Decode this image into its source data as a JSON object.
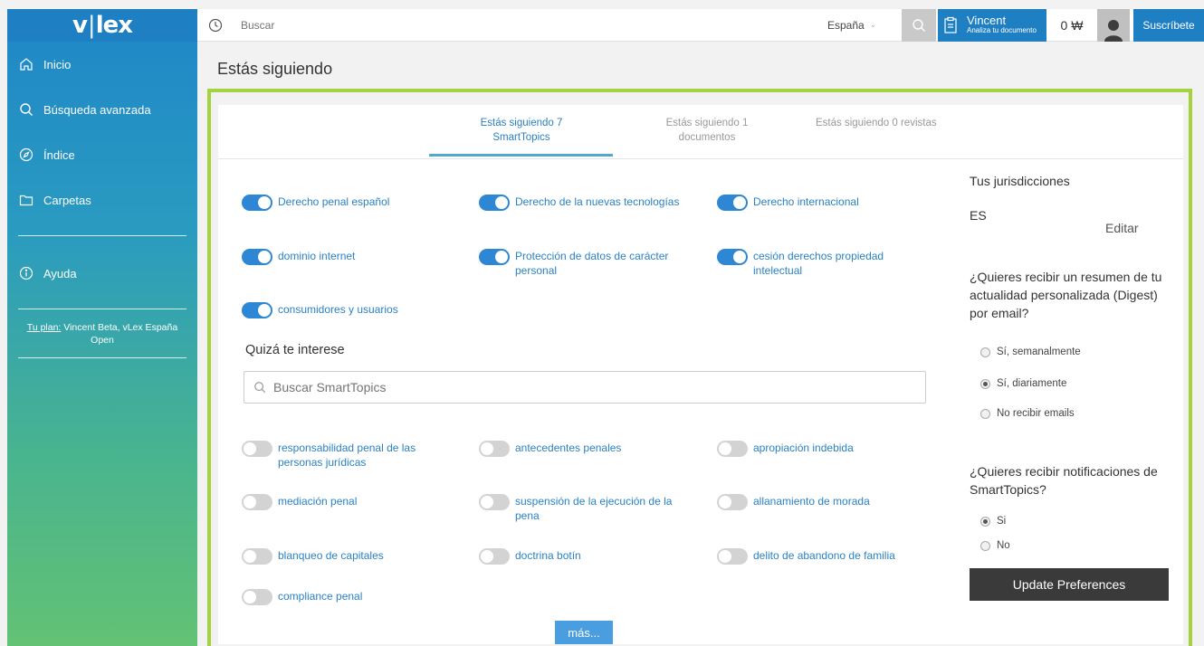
{
  "logo": {
    "left": "v",
    "sep": "|",
    "right": "lex"
  },
  "sidebar": {
    "items": [
      {
        "label": "Inicio",
        "icon": "home-icon"
      },
      {
        "label": "Búsqueda avanzada",
        "icon": "search-icon"
      },
      {
        "label": "Índice",
        "icon": "compass-icon"
      },
      {
        "label": "Carpetas",
        "icon": "folder-icon"
      },
      {
        "label": "Ayuda",
        "icon": "info-icon"
      }
    ],
    "plan_label": "Tu plan:",
    "plan_value": "Vincent Beta, vLex España Open"
  },
  "header": {
    "search_placeholder": "Buscar",
    "country": "España",
    "user_name": "Vincent",
    "user_sub": "Analiza tu documento",
    "credits": "0 ₩",
    "subscribe": "Suscríbete"
  },
  "page_title": "Estás siguiendo",
  "tabs": [
    {
      "label": "Estás siguiendo 7 SmartTopics",
      "active": true
    },
    {
      "label": "Estás siguiendo 1 documentos",
      "active": false
    },
    {
      "label": "Estás siguiendo 0 revistas",
      "active": false
    }
  ],
  "followed_topics": [
    "Derecho penal español",
    "Derecho de la nuevas tecnologías",
    "Derecho internacional",
    "dominio internet",
    "Protección de datos de carácter personal",
    "cesión derechos propiedad intelectual",
    "consumidores y usuarios"
  ],
  "suggestions_title": "Quizá te interese",
  "smarttopics_search_placeholder": "Buscar SmartTopics",
  "suggested_topics": [
    "responsabilidad penal de las personas jurídicas",
    "antecedentes penales",
    "apropiación indebida",
    "mediación penal",
    "suspensión de la ejecución de la pena",
    "allanamiento de morada",
    "blanqueo de capitales",
    "doctrina botín",
    "delito de abandono de familia",
    "compliance penal"
  ],
  "more_button": "más...",
  "right": {
    "jurisdictions_title": "Tus jurisdicciones",
    "jurisdiction_code": "ES",
    "edit": "Editar",
    "digest_question": "¿Quieres recibir un resumen de tu actualidad personalizada (Digest) por email?",
    "digest_options": [
      "Sí, semanalmente",
      "Sí, diariamente",
      "No recibir emails"
    ],
    "digest_selected": "Sí, diariamente",
    "notif_question": "¿Quieres recibir notificaciones de SmartTopics?",
    "notif_options": [
      "Si",
      "No"
    ],
    "notif_selected": "Si",
    "update_button": "Update Preferences"
  },
  "colors": {
    "brand_blue": "#1e7fc2",
    "toggle_on": "#2d87d4",
    "link": "#2b82c3",
    "frame_green": "#a3d33d",
    "update_btn": "#3a3a3a"
  }
}
